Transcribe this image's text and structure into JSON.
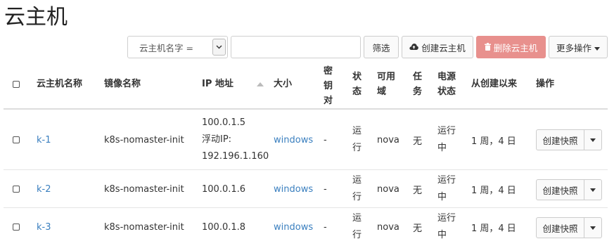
{
  "page": {
    "title": "云主机"
  },
  "toolbar": {
    "filter_select": {
      "selected": "云主机名字 ="
    },
    "search": {
      "value": "",
      "placeholder": ""
    },
    "filter_label": "筛选",
    "create_label": "创建云主机",
    "delete_label": "删除云主机",
    "more_label": "更多操作"
  },
  "table": {
    "headers": {
      "name": "云主机名称",
      "image": "镜像名称",
      "ip": "IP 地址",
      "size": "大小",
      "keypair": [
        "密",
        "钥",
        "对"
      ],
      "status": [
        "状",
        "态"
      ],
      "az": [
        "可用",
        "域"
      ],
      "task": [
        "任",
        "务"
      ],
      "power": [
        "电源",
        "状态"
      ],
      "age": "从创建以来",
      "actions": "操作"
    },
    "rows": [
      {
        "name": "k-1",
        "image": "k8s-nomaster-init",
        "ip": [
          "100.0.1.5",
          "浮动IP:",
          "192.196.1.160"
        ],
        "size": "windows",
        "keypair": "-",
        "status": [
          "运",
          "行"
        ],
        "az": "nova",
        "task": "无",
        "power": [
          "运行",
          "中"
        ],
        "age": "1 周，4 日",
        "action": "创建快照"
      },
      {
        "name": "k-2",
        "image": "k8s-nomaster-init",
        "ip": [
          "100.0.1.6"
        ],
        "size": "windows",
        "keypair": "-",
        "status": [
          "运",
          "行"
        ],
        "az": "nova",
        "task": "无",
        "power": [
          "运行",
          "中"
        ],
        "age": "1 周，4 日",
        "action": "创建快照"
      },
      {
        "name": "k-3",
        "image": "k8s-nomaster-init",
        "ip": [
          "100.0.1.8"
        ],
        "size": "windows",
        "keypair": "-",
        "status": [
          "运",
          "行"
        ],
        "az": "nova",
        "task": "无",
        "power": [
          "运行",
          "中"
        ],
        "age": "1 周，4 日",
        "action": "创建快照"
      }
    ]
  },
  "icons": {
    "select_caret": "chevron-down-icon",
    "create": "cloud-upload-icon",
    "delete": "trash-icon",
    "more": "caret-down-icon",
    "sort": "sort-asc-icon"
  },
  "colors": {
    "link": "#3a7fbf",
    "danger": "#e8908d"
  }
}
